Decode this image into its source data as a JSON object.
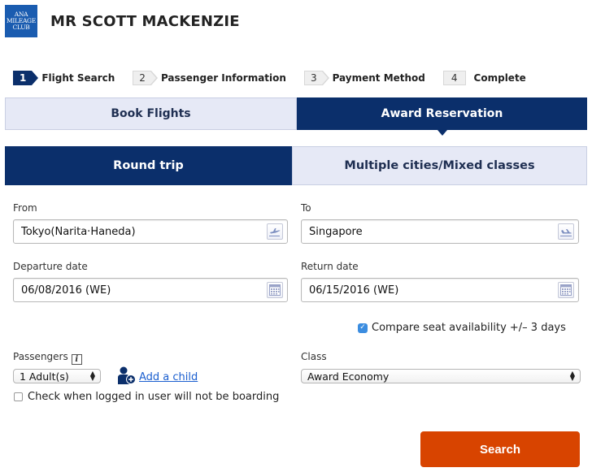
{
  "header": {
    "logo_lines": [
      "ANA",
      "MILEAGE",
      "CLUB"
    ],
    "member_name": "MR SCOTT MACKENZIE"
  },
  "steps": [
    {
      "number": "1",
      "label": "Flight Search",
      "active": true
    },
    {
      "number": "2",
      "label": "Passenger Information",
      "active": false
    },
    {
      "number": "3",
      "label": "Payment Method",
      "active": false
    },
    {
      "number": "4",
      "label": "Complete",
      "active": false
    }
  ],
  "booking_tabs": [
    {
      "label": "Book Flights",
      "selected": false
    },
    {
      "label": "Award Reservation",
      "selected": true
    }
  ],
  "trip_tabs": [
    {
      "label": "Round trip",
      "selected": true
    },
    {
      "label": "Multiple cities/Mixed classes",
      "selected": false
    }
  ],
  "form": {
    "from": {
      "label": "From",
      "value": "Tokyo(Narita·Haneda)",
      "icon": "departure-plane-icon"
    },
    "to": {
      "label": "To",
      "value": "Singapore",
      "icon": "arrival-plane-icon"
    },
    "departure_date": {
      "label": "Departure date",
      "value": "06/08/2016 (WE)",
      "icon": "calendar-icon"
    },
    "return_date": {
      "label": "Return date",
      "value": "06/15/2016 (WE)",
      "icon": "calendar-icon"
    },
    "compare": {
      "label": "Compare seat availability +/– 3 days",
      "checked": true
    },
    "passengers": {
      "label": "Passengers",
      "info_icon": "i",
      "selected": "1 Adult(s)"
    },
    "add_child_label": "Add a child",
    "not_boarding": {
      "label": "Check when logged in user will not be boarding",
      "checked": false
    },
    "class": {
      "label": "Class",
      "selected": "Award Economy"
    }
  },
  "colors": {
    "brand_navy": "#0b2f6b",
    "tab_inactive": "#e6e9f6",
    "logo_blue": "#1a5cb0",
    "search_orange": "#d84400",
    "link_blue": "#1b5fcf"
  },
  "search_button": {
    "label": "Search"
  }
}
